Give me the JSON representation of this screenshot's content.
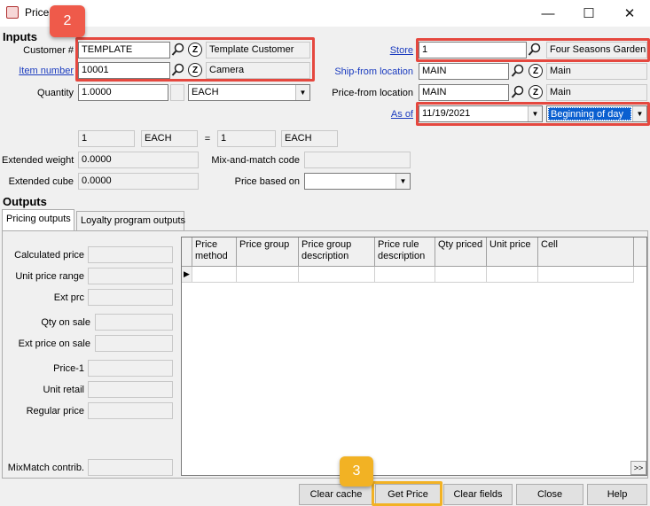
{
  "window": {
    "title": "Price",
    "minimize": "—",
    "maximize": "☐",
    "close": "✕"
  },
  "inputs": {
    "section_title": "Inputs",
    "customer_label": "Customer #",
    "customer_value": "TEMPLATE",
    "customer_name": "Template Customer",
    "item_label": "Item number",
    "item_value": "10001",
    "item_desc": "Camera",
    "quantity_label": "Quantity",
    "quantity_value": "1.0000",
    "unit_value": "EACH",
    "store_label": "Store",
    "store_value": "1",
    "store_name": "Four Seasons Garden C",
    "ship_label": "Ship-from location",
    "ship_value": "MAIN",
    "ship_name": "Main",
    "price_from_label": "Price-from location",
    "price_from_value": "MAIN",
    "price_from_name": "Main",
    "asof_label": "As of",
    "asof_value": "11/19/2021",
    "asof_time": "Beginning of day",
    "conv_qty": "1",
    "conv_unit": "EACH",
    "conv_eq": "=",
    "conv_qty2": "1",
    "conv_unit2": "EACH",
    "ext_weight_label": "Extended weight",
    "ext_weight_value": "0.0000",
    "ext_cube_label": "Extended cube",
    "ext_cube_value": "0.0000",
    "mix_match_label": "Mix-and-match code",
    "price_based_label": "Price based on"
  },
  "outputs": {
    "section_title": "Outputs",
    "tabs": [
      "Pricing outputs",
      "Loyalty program outputs"
    ],
    "left_labels": [
      "Calculated price",
      "Unit price range",
      "Ext prc",
      "Qty on sale",
      "Ext price on sale",
      "Price-1",
      "Unit retail",
      "Regular price",
      "MixMatch contrib."
    ],
    "grid_headers": [
      "Price method",
      "Price group",
      "Price group description",
      "Price rule description",
      "Qty priced",
      "Unit price",
      "Cell"
    ],
    "row_indicator": "▶",
    "scroll_label": ">>"
  },
  "buttons": {
    "clear_cache": "Clear cache",
    "get_price": "Get Price",
    "clear_fields": "Clear fields",
    "close": "Close",
    "help": "Help"
  },
  "annotations": {
    "badge_2": "2",
    "badge_3": "3"
  },
  "colors": {
    "highlight_red": "#e5483f",
    "highlight_orange": "#f2b224",
    "link_blue": "#1a3bbf"
  }
}
